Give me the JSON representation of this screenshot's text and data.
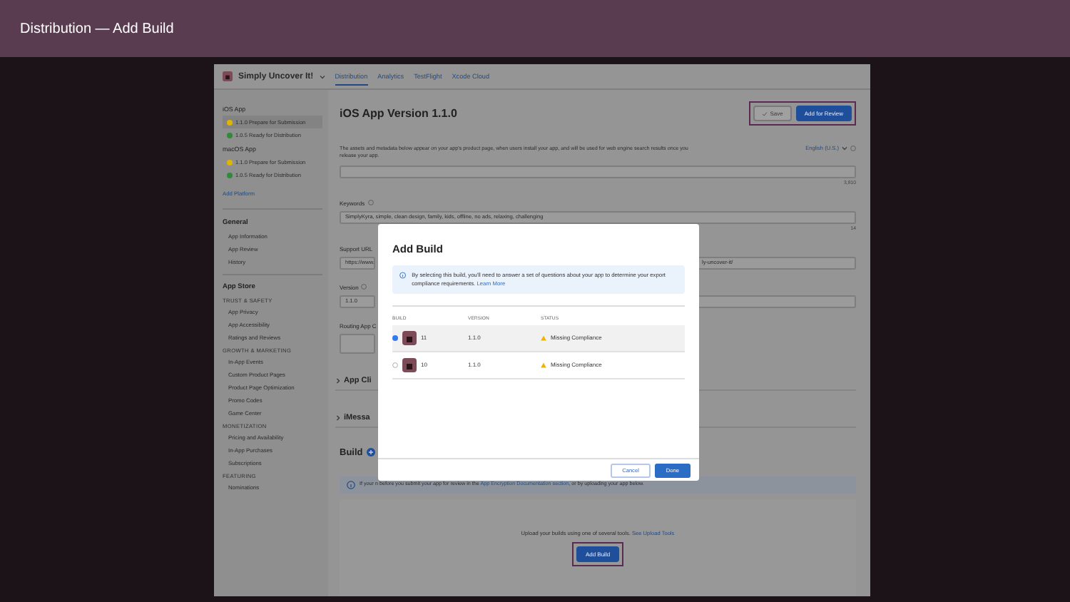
{
  "slide_title": "Distribution — Add Build",
  "app": {
    "name": "Simply Uncover It!",
    "tabs": [
      {
        "label": "Distribution",
        "selected": true
      },
      {
        "label": "Analytics",
        "selected": false
      },
      {
        "label": "TestFlight",
        "selected": false
      },
      {
        "label": "Xcode Cloud",
        "selected": false
      }
    ]
  },
  "sidebar": {
    "platforms": [
      {
        "title": "iOS App",
        "versions": [
          {
            "label": "1.1.0 Prepare for Submission",
            "color": "#e0b400",
            "selected": true
          },
          {
            "label": "1.0.5 Ready for Distribution",
            "color": "#2f8a3a",
            "selected": false
          }
        ]
      },
      {
        "title": "macOS App",
        "versions": [
          {
            "label": "1.1.0 Prepare for Submission",
            "color": "#e0b400",
            "selected": false
          },
          {
            "label": "1.0.5 Ready for Distribution",
            "color": "#2f8a3a",
            "selected": false
          }
        ]
      }
    ],
    "add_platform": "Add Platform",
    "sections": [
      {
        "title": "General",
        "groups": [
          {
            "items": [
              "App Information",
              "App Review",
              "History"
            ]
          }
        ]
      },
      {
        "title": "App Store",
        "groups": [
          {
            "heading": "TRUST & SAFETY",
            "items": [
              "App Privacy",
              "App Accessibility",
              "Ratings and Reviews"
            ]
          },
          {
            "heading": "GROWTH & MARKETING",
            "items": [
              "In-App Events",
              "Custom Product Pages",
              "Product Page Optimization",
              "Promo Codes",
              "Game Center"
            ]
          },
          {
            "heading": "MONETIZATION",
            "items": [
              "Pricing and Availability",
              "In-App Purchases",
              "Subscriptions"
            ]
          },
          {
            "heading": "FEATURING",
            "items": [
              "Nominations"
            ]
          }
        ]
      }
    ]
  },
  "page": {
    "title": "iOS App Version 1.1.0",
    "buttons": [
      {
        "label": "Save",
        "kind": "secondary",
        "disabled": true
      },
      {
        "label": "Add for Review",
        "kind": "primary",
        "disabled": false
      }
    ],
    "description": "The assets and metadata below appear on your app's product page, when users install your app, and will be used for web engine search results once you release your app.",
    "language": "English (U.S.)",
    "promo_counter": "3,810",
    "keywords": {
      "label": "Keywords",
      "value": "SimplyKyra, simple, clean design, family, kids, offline, no ads, relaxing, challenging",
      "counter": "14"
    },
    "support_url": {
      "label": "Support URL",
      "value_start": "https://www.",
      "value_end": "ly-uncover-it/"
    },
    "version": {
      "label": "Version",
      "value": "1.1.0"
    },
    "routing": {
      "label": "Routing App C"
    },
    "collapsed_sections": [
      "App Cli",
      "iMessa"
    ],
    "build": {
      "title": "Build",
      "notice_start": "If your",
      "notice_end": "n before you submit your app for review in the",
      "notice_link": "App Encryption Documentation section",
      "notice_tail": ", or by uploading your app below.",
      "upload_text": "Upload your builds using one of several tools.",
      "upload_link": "See Upload Tools",
      "add_button": "Add Build"
    }
  },
  "dialog": {
    "title": "Add Build",
    "info": "By selecting this build, you'll need to answer a set of questions about your app to determine your export compliance requirements.",
    "info_link": "Learn More",
    "columns": [
      "BUILD",
      "VERSION",
      "STATUS"
    ],
    "rows": [
      {
        "build": "11",
        "version": "1.1.0",
        "status": "Missing Compliance",
        "selected": true
      },
      {
        "build": "10",
        "version": "1.1.0",
        "status": "Missing Compliance",
        "selected": false
      }
    ],
    "buttons": [
      {
        "label": "Cancel",
        "kind": "secondary"
      },
      {
        "label": "Done",
        "kind": "primary"
      }
    ]
  }
}
